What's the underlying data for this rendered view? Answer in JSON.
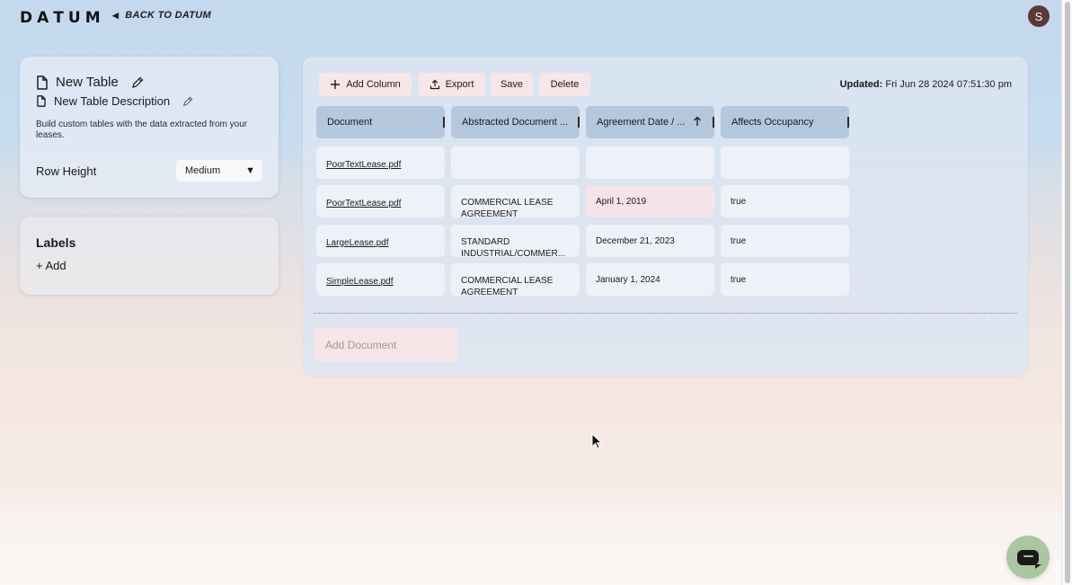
{
  "topbar": {
    "logo_letters": [
      "D",
      "A",
      "T",
      "U",
      "M"
    ],
    "back_label": "BACK TO DATUM",
    "avatar_initial": "S"
  },
  "table_info": {
    "title": "New Table",
    "description": "New Table Description",
    "help_text": "Build custom tables with the data extracted from your leases.",
    "row_height_label": "Row Height",
    "row_height_value": "Medium"
  },
  "labels": {
    "title": "Labels",
    "add_label": "+ Add"
  },
  "toolbar": {
    "add_column": "Add Column",
    "export": "Export",
    "save": "Save",
    "delete": "Delete",
    "updated_label": "Updated:",
    "updated_value": "Fri Jun 28 2024 07:51:30 pm"
  },
  "grid": {
    "columns": [
      "Document",
      "Abstracted Document ...",
      "Agreement Date / ...",
      "Affects Occupancy"
    ],
    "rows": [
      {
        "document": "PoorTextLease.pdf",
        "abstracted": "",
        "agreement_date": "",
        "affects": ""
      },
      {
        "document": "PoorTextLease.pdf",
        "abstracted": "COMMERCIAL LEASE AGREEMENT",
        "agreement_date": "April 1, 2019",
        "affects": "true"
      },
      {
        "document": "LargeLease.pdf",
        "abstracted": "STANDARD INDUSTRIAL/COMMER...",
        "agreement_date": "December 21, 2023",
        "affects": "true"
      },
      {
        "document": "SimpleLease.pdf",
        "abstracted": "COMMERCIAL LEASE AGREEMENT",
        "agreement_date": "January 1, 2024",
        "affects": "true"
      }
    ],
    "add_document_placeholder": "Add Document",
    "highlight_color": "#f4e4ea"
  },
  "icons": {
    "document": "document-icon",
    "edit": "pencil-icon",
    "sort": "arrow-up-icon",
    "chat": "chat-bubble-icon"
  }
}
